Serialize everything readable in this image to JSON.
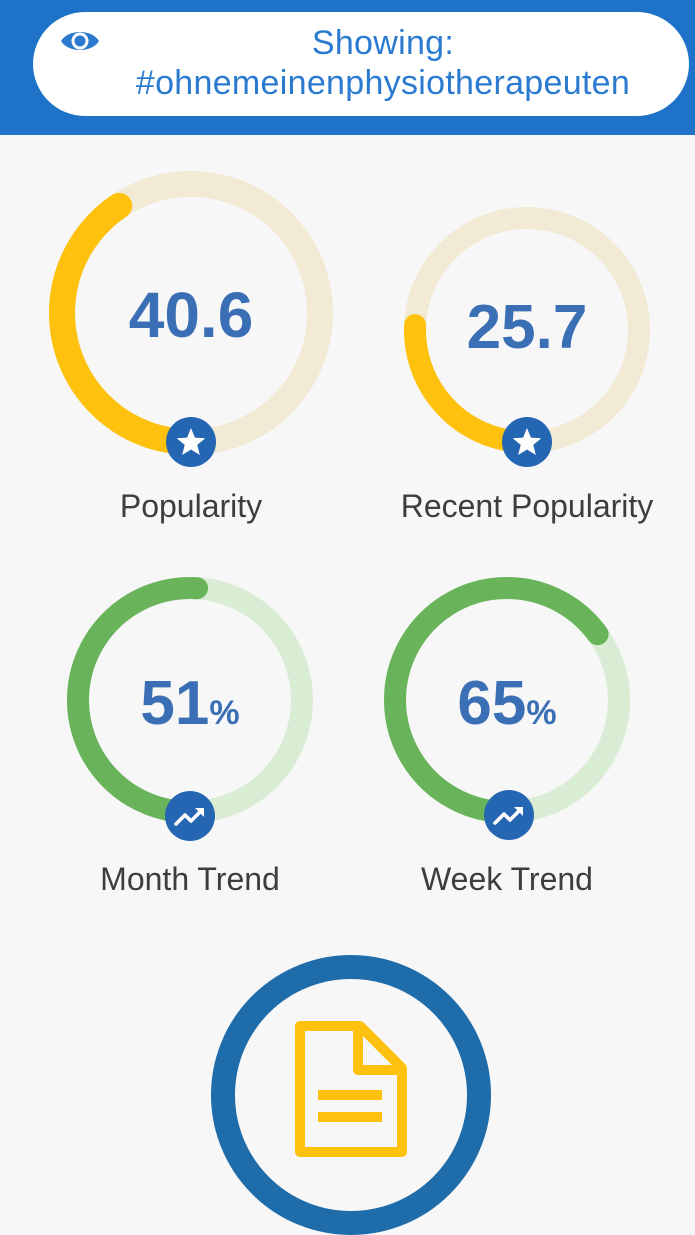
{
  "header": {
    "eye_icon": "eye-icon",
    "showing_label": "Showing:",
    "hashtag": "#ohnemeinenphysiotherapeuten",
    "background_color": "#1e73c8"
  },
  "gauges": [
    {
      "id": "popularity",
      "value": "40.6",
      "unit": "",
      "label": "Popularity",
      "fill_fraction": 0.406,
      "badge_icon": "star-icon",
      "arc_color": "#fec10d",
      "track_color": "#f2ead5"
    },
    {
      "id": "recent-popularity",
      "value": "25.7",
      "unit": "",
      "label": "Recent Popularity",
      "fill_fraction": 0.257,
      "badge_icon": "star-icon",
      "arc_color": "#fec10d",
      "track_color": "#f2ead5"
    },
    {
      "id": "month-trend",
      "value": "51",
      "unit": "%",
      "label": "Month Trend",
      "fill_fraction": 0.51,
      "badge_icon": "trend-up-icon",
      "arc_color": "#69b45b",
      "track_color": "#d9ecd4"
    },
    {
      "id": "week-trend",
      "value": "65",
      "unit": "%",
      "label": "Week Trend",
      "fill_fraction": 0.65,
      "badge_icon": "trend-up-icon",
      "arc_color": "#69b45b",
      "track_color": "#d9ecd4"
    }
  ],
  "report_button": {
    "icon": "document-icon",
    "ring_color": "#1f6cab",
    "icon_color": "#fec10d"
  }
}
